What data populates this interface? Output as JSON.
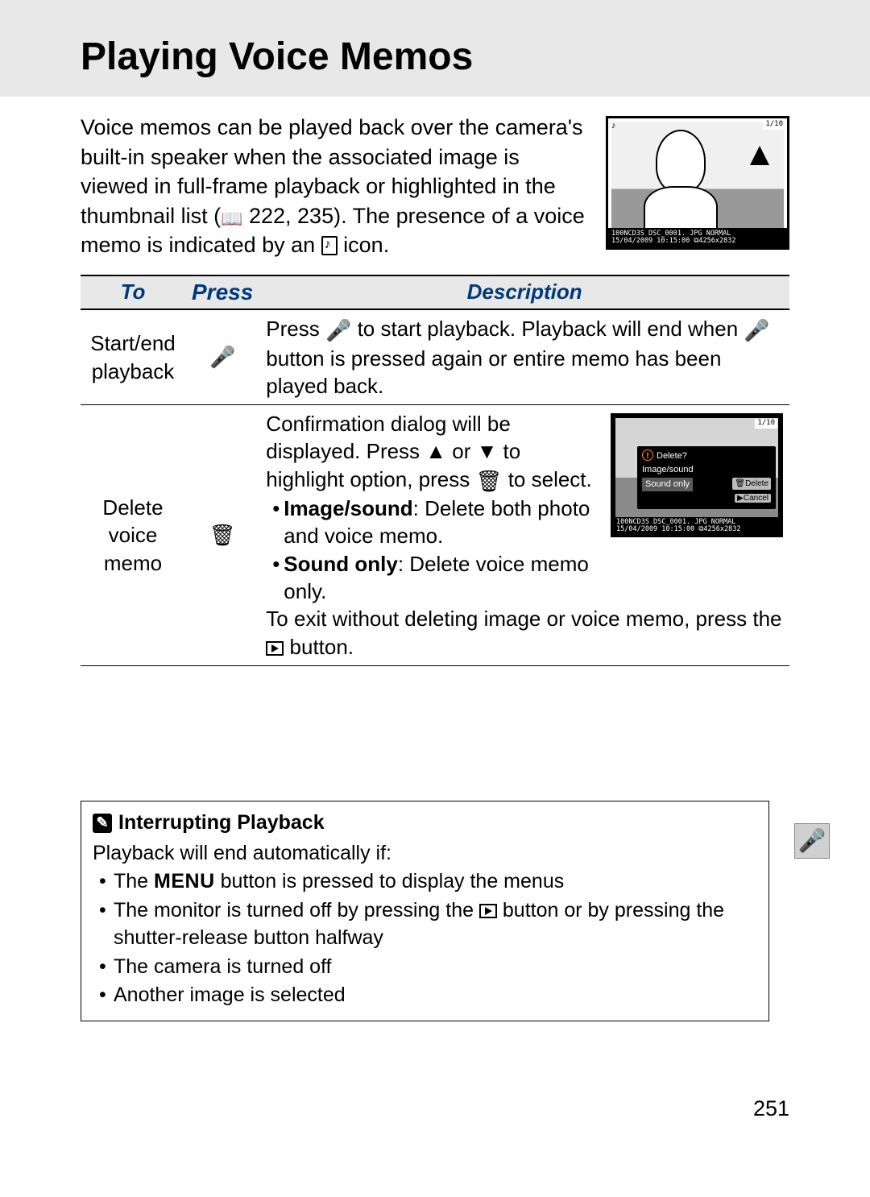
{
  "title": "Playing Voice Memos",
  "intro": {
    "line1": "Voice memos can be played back over the camera's built-in speaker when the associated image is viewed in full-frame playback or highlighted in the thumbnail list (",
    "refs": " 222, 235).  The presence of a voice memo is indicated by an ",
    "line_end": " icon."
  },
  "illustration": {
    "counter": "1/10",
    "footer_l1": "100NCD3S DSC_0001. JPG        NORMAL",
    "footer_l2": "15/04/2009 10:15:00    ⧉4256x2832"
  },
  "table": {
    "headers": {
      "to": "To",
      "press": "Press",
      "desc": "Description"
    },
    "rows": [
      {
        "to": "Start/end playback",
        "press_icon": "mic",
        "desc_pre": "Press ",
        "desc_mid": " to start playback. Playback will end when ",
        "desc_post": " button is pressed again or entire memo has been played back."
      },
      {
        "to": "Delete voice memo",
        "press_icon": "trash",
        "desc_para1_a": "Confirmation dialog will be displayed. Press ▲ or ▼ to highlight option, press ",
        "desc_para1_b": " to select.",
        "bullet1_bold": "Image/sound",
        "bullet1_rest": ": Delete both photo and voice memo.",
        "bullet2_bold": "Sound only",
        "bullet2_rest": ": Delete voice memo only.",
        "desc_para2_a": "To exit without deleting image or voice memo, press the ",
        "desc_para2_b": " button.",
        "dialog": {
          "title": "Delete?",
          "opt1": "Image/sound",
          "opt2": "Sound only",
          "btn_delete": "🗑Delete",
          "btn_cancel": "▶Cancel",
          "counter": "1/10",
          "footer_l1": "100NCD3S DSC_0001. JPG       NORMAL",
          "footer_l2": "15/04/2009 10:15:00   ⧉4256x2832"
        }
      }
    ]
  },
  "note": {
    "title": "Interrupting Playback",
    "intro": "Playback will end automatically if:",
    "items": {
      "i1_a": "The ",
      "i1_menu": "MENU",
      "i1_b": " button is pressed to display the menus",
      "i2_a": "The monitor is turned off by pressing the ",
      "i2_b": " button or by pressing the shutter-release button halfway",
      "i3": "The camera is turned off",
      "i4": "Another image is selected"
    }
  },
  "page_number": "251"
}
